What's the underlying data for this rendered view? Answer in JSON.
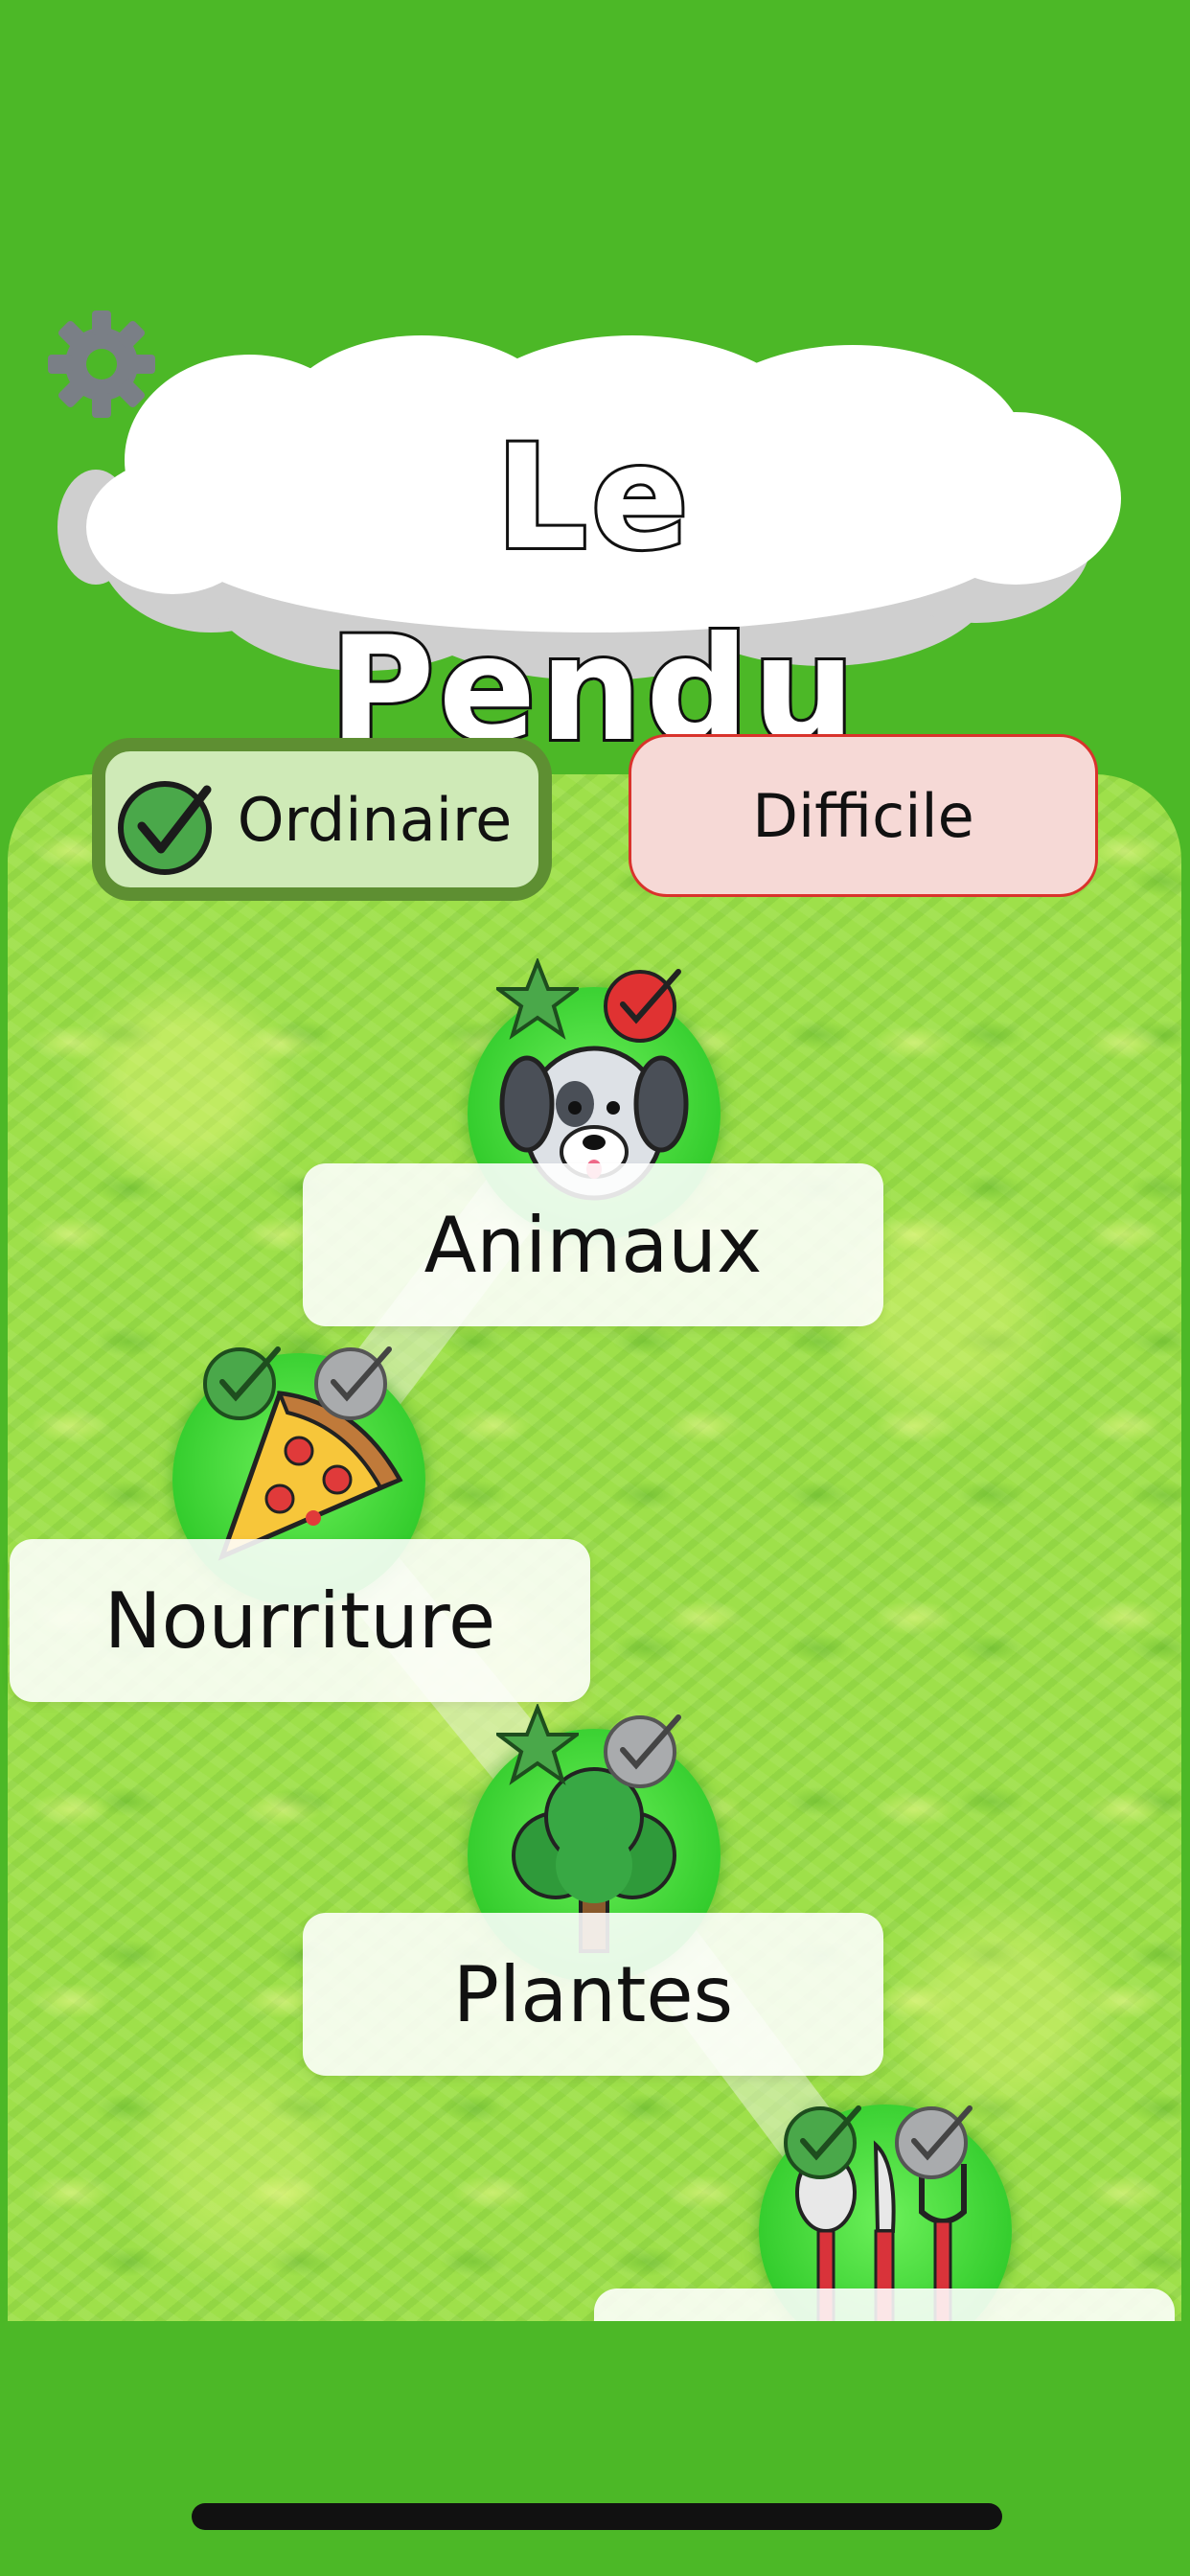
{
  "app": {
    "title": "Le Pendu"
  },
  "modes": {
    "ordinaire": {
      "label": "Ordinaire",
      "selected": true
    },
    "difficile": {
      "label": "Difficile",
      "selected": false
    }
  },
  "categories": [
    {
      "label": "Animaux",
      "icon": "dog-face-icon",
      "badges": [
        "star-icon",
        "check-red-icon"
      ]
    },
    {
      "label": "Nourriture",
      "icon": "pizza-slice-icon",
      "badges": [
        "check-green-icon",
        "check-gray-icon"
      ]
    },
    {
      "label": "Plantes",
      "icon": "tree-icon",
      "badges": [
        "star-icon",
        "check-gray-icon"
      ]
    },
    {
      "label": "",
      "icon": "cutlery-icon",
      "badges": [
        "check-green-icon",
        "check-gray-icon"
      ]
    }
  ],
  "colors": {
    "background": "#4cb827",
    "grass": "#9ee04a",
    "node": "#33cc2c",
    "selected_border": "#5e8f32",
    "difficile_border": "#d9332c"
  }
}
